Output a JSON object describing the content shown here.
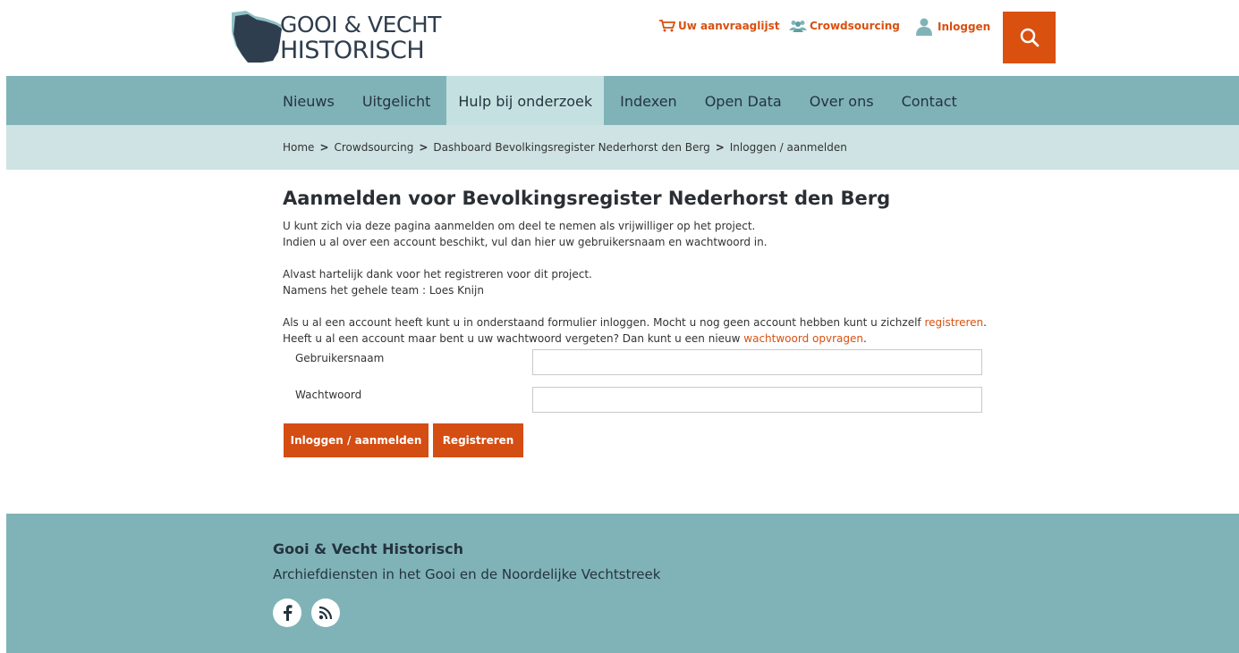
{
  "logo": {
    "line1": "GOOI & VECHT",
    "line2": "HISTORISCH"
  },
  "toplinks": {
    "cart": "Uw aanvraaglijst",
    "crowd": "Crowdsourcing",
    "login": "Inloggen"
  },
  "nav": [
    "Nieuws",
    "Uitgelicht",
    "Hulp bij onderzoek",
    "Indexen",
    "Open Data",
    "Over ons",
    "Contact"
  ],
  "breadcrumb": [
    "Home",
    "Crowdsourcing",
    "Dashboard Bevolkingsregister Nederhorst den Berg",
    "Inloggen / aanmelden"
  ],
  "main": {
    "title": "Aanmelden voor Bevolkingsregister Nederhorst den Berg",
    "p1a": "U kunt zich via deze pagina aanmelden om deel te nemen als vrijwilliger op het project.",
    "p1b": "Indien u al over een account beschikt, vul dan hier uw gebruikersnaam en wachtwoord in.",
    "p2a": "Alvast hartelijk dank voor het registreren voor dit project.",
    "p2b": "Namens het gehele team : Loes Knijn",
    "p3a": "Als u al een account heeft kunt u in onderstaand formulier inloggen. Mocht u nog geen account hebben kunt u zichzelf ",
    "p3a_link": "registreren",
    "p3a_end": ".",
    "p3b": "Heeft u al een account maar bent u uw wachtwoord vergeten? Dan kunt u een nieuw ",
    "p3b_link": "wachtwoord opvragen",
    "p3b_end": "."
  },
  "form": {
    "username_label": "Gebruikersnaam",
    "username_value": "",
    "password_label": "Wachtwoord",
    "password_value": "",
    "login_button": "Inloggen / aanmelden",
    "register_button": "Registreren"
  },
  "footer": {
    "title": "Gooi & Vecht Historisch",
    "subtitle": "Archiefdiensten in het Gooi en de Noordelijke Vechtstreek"
  },
  "icons": [
    "cart-icon",
    "group-icon",
    "user-icon",
    "search-icon",
    "facebook-icon",
    "rss-icon"
  ],
  "colors": {
    "accent": "#d9500f",
    "nav": "#80b3b7",
    "crumbs": "#cfe3e4",
    "active_tab": "#c5e0e1"
  }
}
